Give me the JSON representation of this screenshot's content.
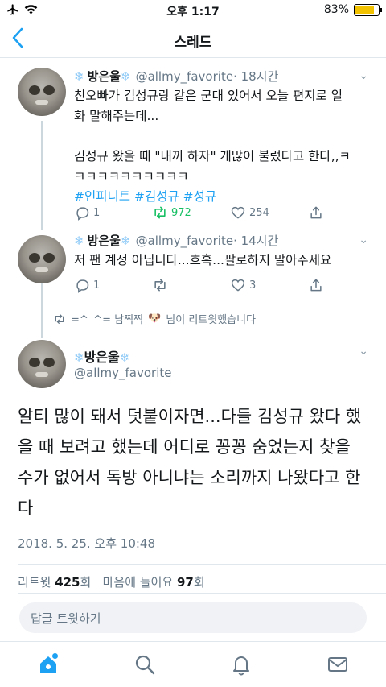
{
  "status": {
    "time": "오후 1:17",
    "battery": "83%",
    "battery_level": 0.83
  },
  "nav": {
    "title": "스레드"
  },
  "tweets": [
    {
      "name": "방은울",
      "handle": "@allmy_favorite",
      "time": "· 18시간",
      "text": "친오빠가 김성규랑 같은 군대 있어서 오늘 편지로 일\n화 말해주는데...\n\n김성규 왔을 때 \"내꺼 하자\" 개많이 불렀다고 한다,,ㅋ\nㅋㅋㅋㅋㅋㅋㅋㅋㅋㅋ",
      "tags": "#인피니트 #김성규 #성규",
      "replies": "1",
      "retweets": "972",
      "likes": "254"
    },
    {
      "name": "방은울",
      "handle": "@allmy_favorite",
      "time": "· 14시간",
      "text": "저 팬 계정 아닙니다...흐흑...팔로하지 말아주세요",
      "replies": "1",
      "retweets": "",
      "likes": "3"
    }
  ],
  "retweet_note": {
    "prefix": "=^_^= 남찍찍",
    "suffix": "님이 리트윗했습니다"
  },
  "main": {
    "name": "방은울",
    "handle": "@allmy_favorite",
    "text": "알티 많이 돼서 덧붙이자면...다들 김성규 왔다 했을 때 보려고 했는데 어디로 꽁꽁 숨었는지 찾을 수가 없어서 독방 아니냐는 소리까지 나왔다고 한다",
    "timestamp": "2018. 5. 25. 오후 10:48",
    "retweet_label": "리트윗",
    "retweet_count": "425",
    "retweet_unit": "회",
    "like_label": "마음에 들어요",
    "like_count": "97",
    "like_unit": "회"
  },
  "reply_placeholder": "답글 트윗하기",
  "colors": {
    "accent": "#1da1f2",
    "retweet": "#17bf63",
    "muted": "#657786"
  }
}
